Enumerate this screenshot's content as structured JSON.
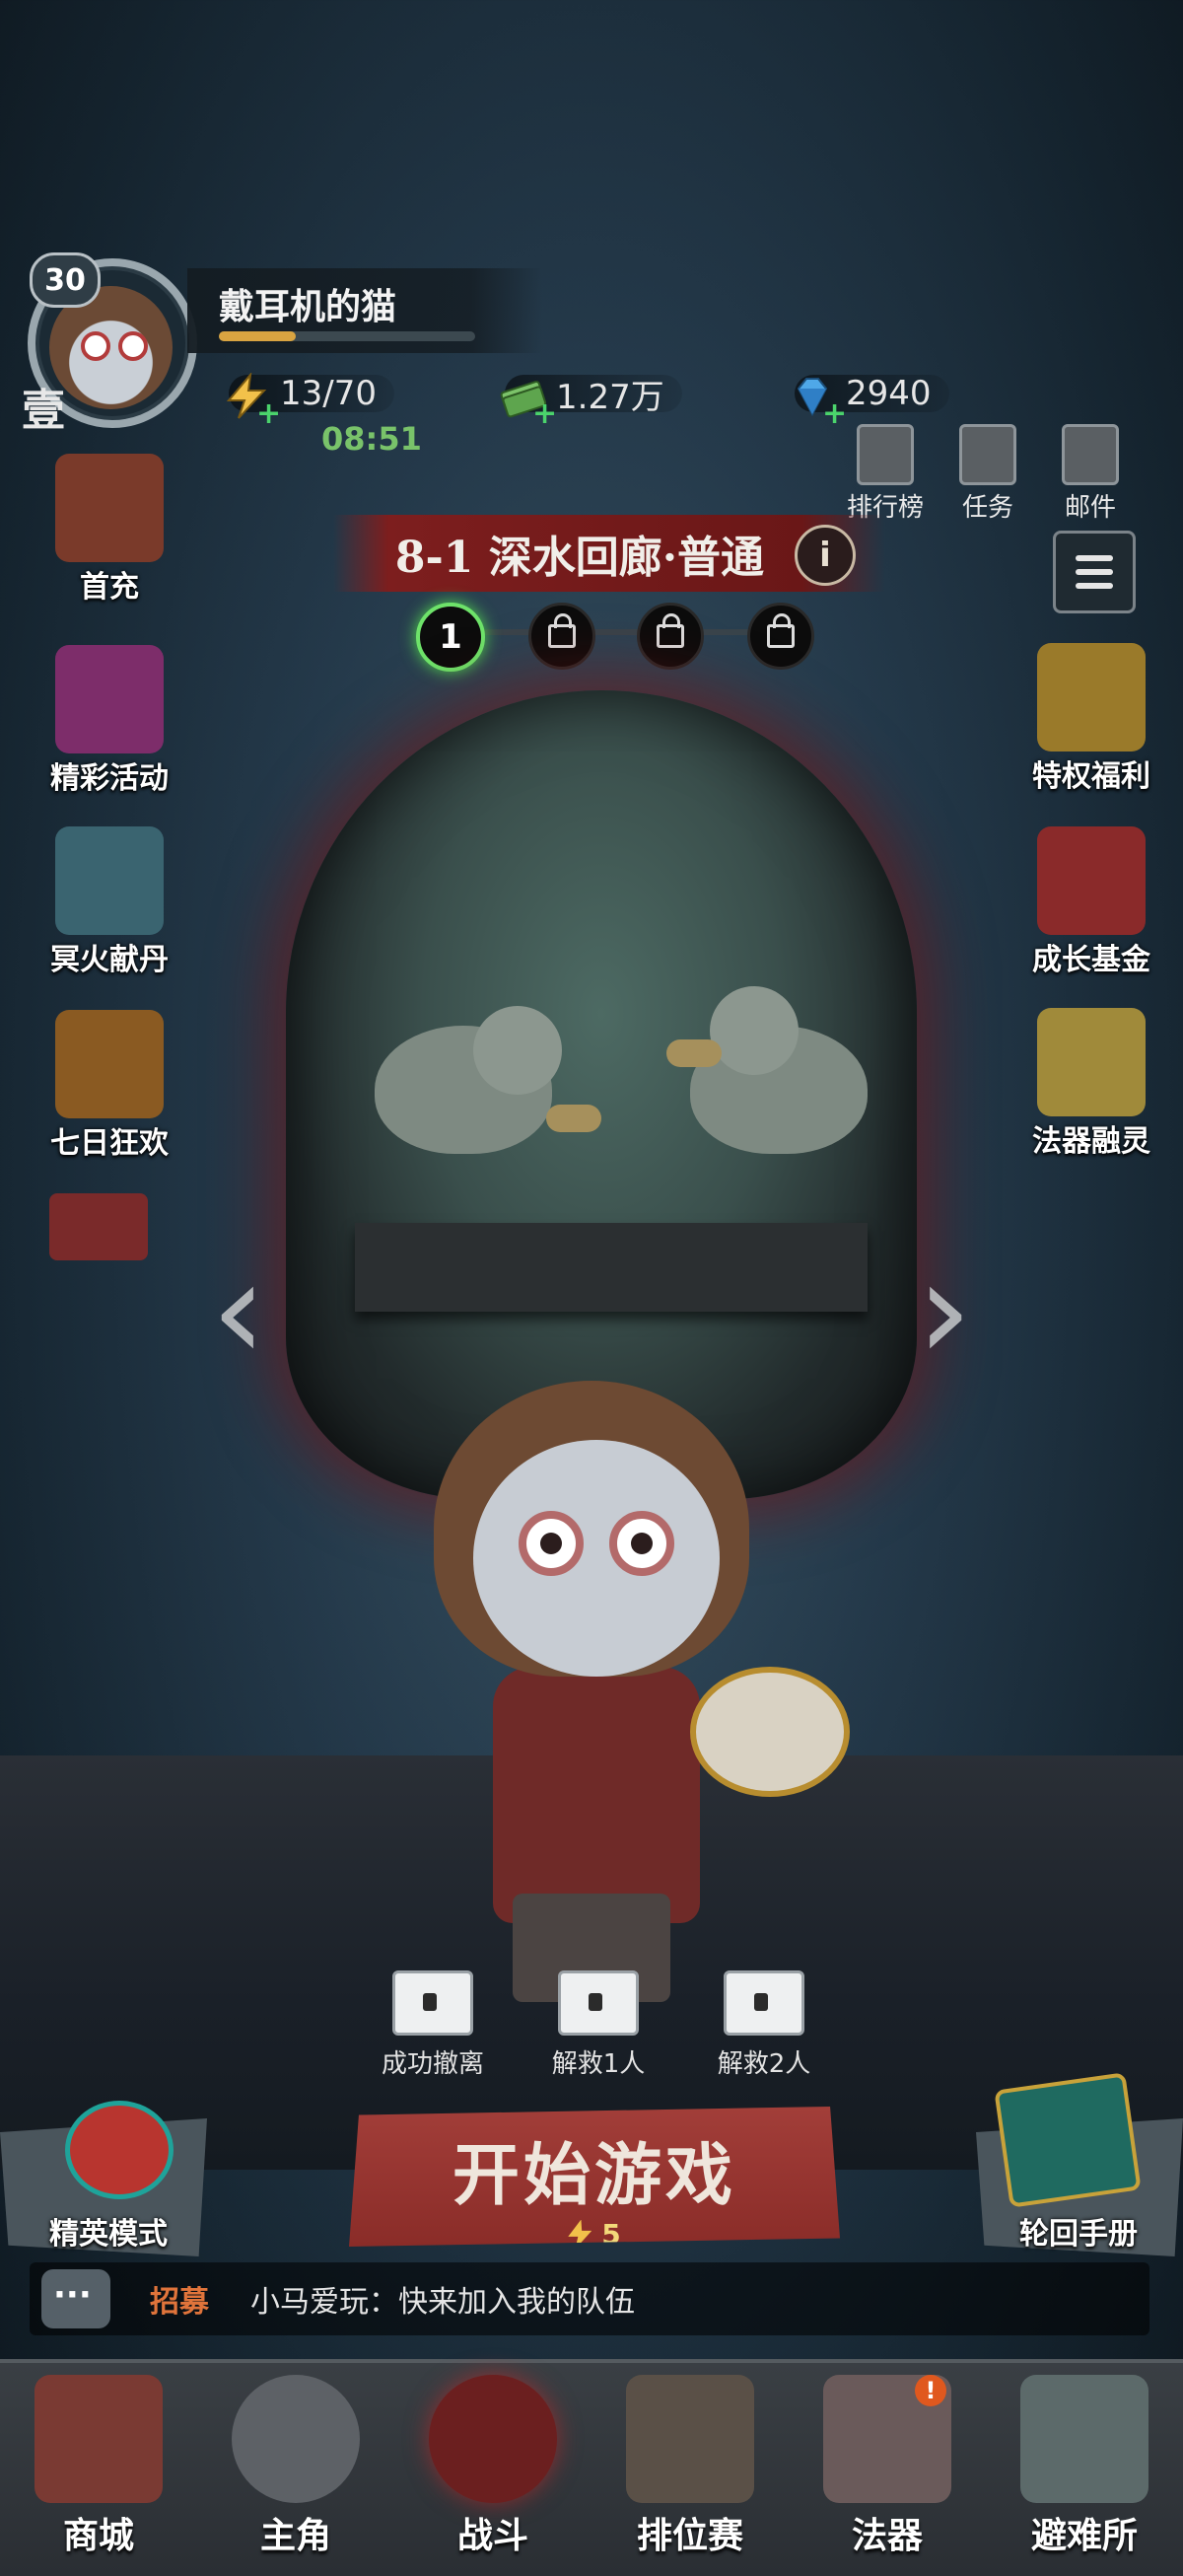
{
  "player": {
    "level": "30",
    "rank_char": "壹",
    "name": "戴耳机的猫",
    "xp_progress": 0.3
  },
  "resources": {
    "stamina": "13/70",
    "stamina_timer": "08:51",
    "cash": "1.27万",
    "gems": "2940"
  },
  "top_menu": [
    {
      "label": "排行榜",
      "icon": "trophy-icon"
    },
    {
      "label": "任务",
      "icon": "scroll-icon"
    },
    {
      "label": "邮件",
      "icon": "mail-icon"
    }
  ],
  "stage": {
    "title": "8-1 深水回廊·普通",
    "info": "i",
    "current_node": "1",
    "locked_nodes": 3
  },
  "left_menu": [
    {
      "label": "首充",
      "icon": "first-recharge-icon",
      "color": "#7a3a2a"
    },
    {
      "label": "精彩活动",
      "icon": "gift-icon",
      "color": "#7d2d6a"
    },
    {
      "label": "冥火献丹",
      "icon": "lantern-icon",
      "color": "#3a6470"
    },
    {
      "label": "七日狂欢",
      "icon": "seven-day-icon",
      "color": "#8a5a22"
    }
  ],
  "right_menu": [
    {
      "label": "特权福利",
      "icon": "privilege-card-icon",
      "color": "#9a7a2a"
    },
    {
      "label": "成长基金",
      "icon": "growth-fund-icon",
      "color": "#8a2a2a"
    },
    {
      "label": "法器融灵",
      "icon": "artifact-fusion-icon",
      "color": "#a08a3a"
    }
  ],
  "objectives": [
    {
      "label": "成功撤离"
    },
    {
      "label": "解救1人"
    },
    {
      "label": "解救2人"
    }
  ],
  "actions": {
    "elite_mode": "精英模式",
    "start_game": "开始游戏",
    "start_cost": "5",
    "samsara_manual": "轮回手册"
  },
  "chat": {
    "tag": "招募",
    "message": "小马爱玩：快来加入我的队伍"
  },
  "bottom_nav": [
    {
      "label": "商城",
      "icon": "shop-icon"
    },
    {
      "label": "主角",
      "icon": "character-icon"
    },
    {
      "label": "战斗",
      "icon": "battle-icon",
      "active": true
    },
    {
      "label": "排位赛",
      "icon": "ranked-icon"
    },
    {
      "label": "法器",
      "icon": "artifact-icon",
      "badge": "!"
    },
    {
      "label": "避难所",
      "icon": "shelter-icon"
    }
  ]
}
